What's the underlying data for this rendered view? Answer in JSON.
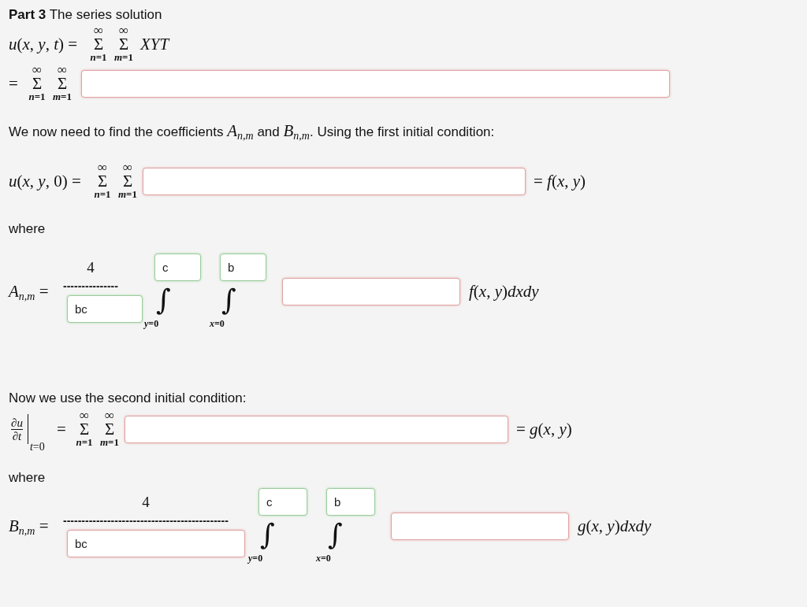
{
  "heading": "**Part 3** The series solution",
  "series_definition": {
    "lhs": "*u*(*x*, *y*, *t*) =",
    "sums": [
      {
        "upper": "∞",
        "symbol": "Σ",
        "lower": "*n*=1"
      },
      {
        "upper": "∞",
        "symbol": "Σ",
        "lower": "*m*=1"
      }
    ],
    "term": "XYT"
  },
  "series_answer": {
    "lhs": "=",
    "sums": [
      {
        "upper": "∞",
        "symbol": "Σ",
        "lower": "*n*=1"
      },
      {
        "upper": "∞",
        "symbol": "Σ",
        "lower": "*m*=1"
      }
    ],
    "answer": {
      "correct": false
    }
  },
  "intro": "We now need to find the coefficients *A*$_{n,m}$ and *B*$_{n,m}$. Using the first initial condition:",
  "first_condition": {
    "lhs": "*u*(*x*, *y*, 0) =",
    "sums": [
      {
        "upper": "∞",
        "symbol": "Σ",
        "lower": "*n*=1"
      },
      {
        "upper": "∞",
        "symbol": "Σ",
        "lower": "*m*=1"
      }
    ],
    "answer": {
      "correct": false
    },
    "rhs": "= *f*(*x*, *y*)"
  },
  "where_1": "where",
  "coefficient_a": {
    "lhs": "*A*$_{n,m}$ =",
    "numerator": "4",
    "fraction_bar": "---------------",
    "denominator": {
      "value": "bc",
      "correct": true
    },
    "integrals": [
      {
        "upper": {
          "value": "c",
          "correct": true
        },
        "symbol": "∫",
        "lower": "*y*=0"
      },
      {
        "upper": {
          "value": "b",
          "correct": true
        },
        "symbol": "∫",
        "lower": "*x*=0"
      }
    ],
    "integrand": {
      "correct": false
    },
    "rhs": "*f*(*x*, *y*)*dxdy*"
  },
  "second_intro": "Now we use the second initial condition:",
  "second_condition": {
    "derivative": {
      "numerator": "∂*u*",
      "denominator": "∂*t*",
      "evaluated_at": "*t*=0"
    },
    "equals": "=",
    "sums": [
      {
        "upper": "∞",
        "symbol": "Σ",
        "lower": "*n*=1"
      },
      {
        "upper": "∞",
        "symbol": "Σ",
        "lower": "*m*=1"
      }
    ],
    "answer": {
      "correct": false
    },
    "rhs": "= *g*(*x*, *y*)"
  },
  "where_2": "where",
  "coefficient_b": {
    "lhs": "*B*$_{n,m}$ =",
    "numerator": "4",
    "fraction_bar": "---------------------------------------------",
    "denominator": {
      "value": "bc",
      "correct": false
    },
    "integrals": [
      {
        "upper": {
          "value": "c",
          "correct": true
        },
        "symbol": "∫",
        "lower": "*y*=0"
      },
      {
        "upper": {
          "value": "b",
          "correct": true
        },
        "symbol": "∫",
        "lower": "*x*=0"
      }
    ],
    "integrand": {
      "correct": false
    },
    "rhs": "*g*(*x*, *y*)*dxdy*"
  }
}
